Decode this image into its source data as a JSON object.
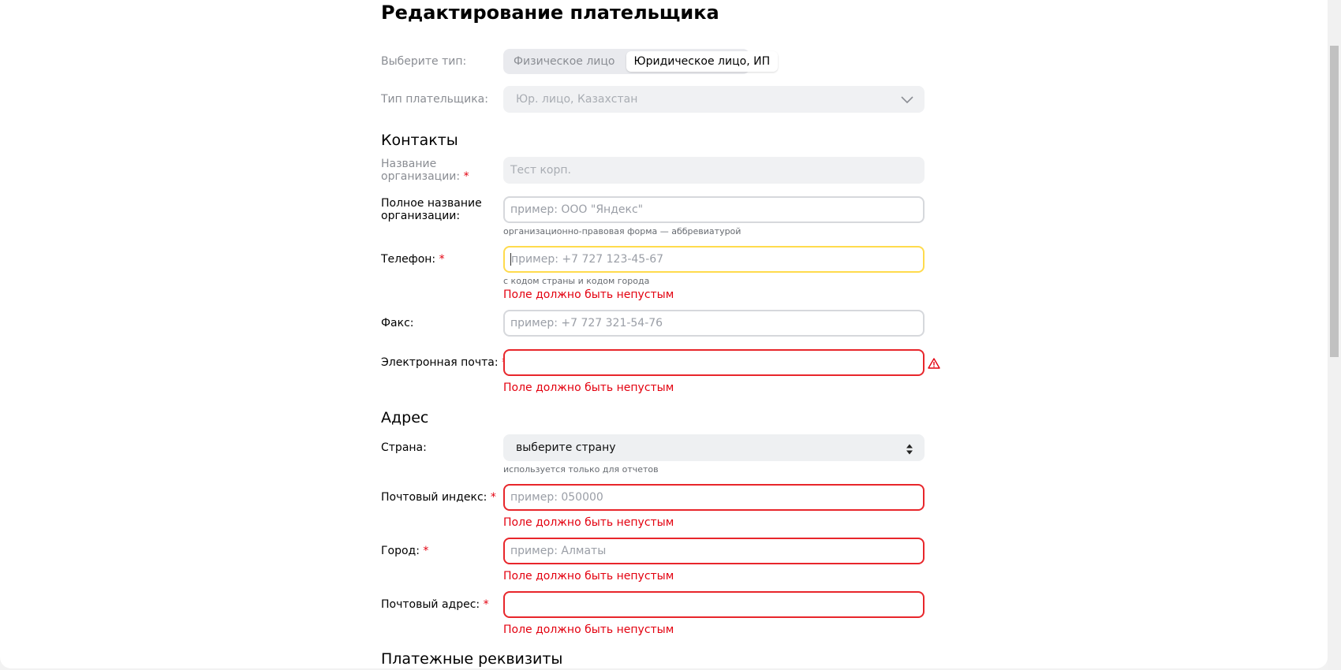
{
  "page_title": "Редактирование плательщика",
  "type_selector": {
    "label": "Выберите тип:",
    "options": [
      "Физическое лицо",
      "Юридическое лицо, ИП"
    ],
    "selected": "Юридическое лицо, ИП"
  },
  "payer_type": {
    "label": "Тип плательщика:",
    "value": "Юр. лицо, Казахстан"
  },
  "contacts": {
    "heading": "Контакты",
    "org_name": {
      "label": "Название организации:",
      "value": "Тест корп."
    },
    "full_org_name": {
      "label": "Полное название организации:",
      "placeholder": "пример: ООО \"Яндекс\"",
      "hint": "организационно-правовая форма — аббревиатурой"
    },
    "phone": {
      "label": "Телефон:",
      "placeholder": "пример: +7 727 123-45-67",
      "hint": "с кодом страны и кодом города",
      "error": "Поле должно быть непустым"
    },
    "fax": {
      "label": "Факс:",
      "placeholder": "пример: +7 727 321-54-76"
    },
    "email": {
      "label": "Электронная почта:",
      "value": "",
      "error": "Поле должно быть непустым"
    }
  },
  "address": {
    "heading": "Адрес",
    "country": {
      "label": "Страна:",
      "value": "выберите страну",
      "hint": "используется только для отчетов"
    },
    "postal_code": {
      "label": "Почтовый индекс:",
      "placeholder": "пример: 050000",
      "error": "Поле должно быть непустым"
    },
    "city": {
      "label": "Город:",
      "placeholder": "пример: Алматы",
      "error": "Поле должно быть непустым"
    },
    "postal_address": {
      "label": "Почтовый адрес:",
      "value": "",
      "error": "Поле должно быть непустым"
    }
  },
  "payment_details": {
    "heading": "Платежные реквизиты"
  },
  "required_mark": "*",
  "colors": {
    "error": "#e3000f",
    "focus": "#ffdb4d",
    "muted": "#8a8d93"
  }
}
